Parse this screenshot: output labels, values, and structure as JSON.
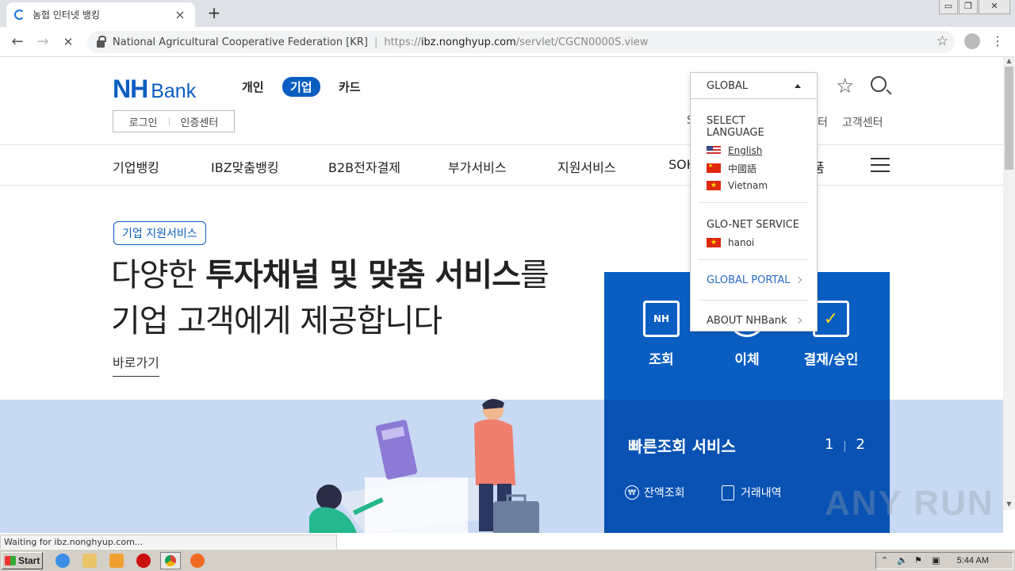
{
  "browser": {
    "tab_title": "농협 인터넷 뱅킹",
    "tab_close": "×",
    "new_tab": "+",
    "win_min": "▭",
    "win_max": "❐",
    "win_close": "✕",
    "back": "←",
    "forward": "→",
    "reload": "✕",
    "site_name": "National Agricultural Cooperative Federation [KR]",
    "url_scheme": "https://",
    "url_host": "ibz.nonghyup.com",
    "url_path": "/servlet/CGCN0000S.view",
    "star": "☆",
    "menu": "⋮",
    "status_text": "Waiting for ibz.nonghyup.com..."
  },
  "header": {
    "logo_nh": "NH",
    "logo_bank": "Bank",
    "segments": [
      "개인",
      "기업",
      "카드"
    ],
    "active_segment": "기업",
    "login": "로그인",
    "cert": "인증센터",
    "util_links": [
      "터",
      "고객센터"
    ],
    "util_partial": "S",
    "global": "GLOBAL"
  },
  "gnb": [
    "기업뱅킹",
    "IBZ맞춤뱅킹",
    "B2B전자결제",
    "부가서비스",
    "지원서비스",
    "SOH",
    "품"
  ],
  "hero": {
    "badge": "기업 지원서비스",
    "line1_pre": "다양한 ",
    "line1_bold": "투자채널 및 맞춤 서비스",
    "line1_post": "를",
    "line2": "기업 고객에게 제공합니다",
    "shortcut": "바로가기"
  },
  "quick_panel": {
    "icons": [
      {
        "label": "조회",
        "glyph": "NH"
      },
      {
        "label": "이체",
        "glyph": ""
      },
      {
        "label": "결재/승인",
        "glyph": "✓"
      }
    ],
    "title": "빠른조회 서비스",
    "page_current": "1",
    "page_sep": "|",
    "page_total": "2",
    "link1": "잔액조회",
    "link1_glyph": "₩",
    "link2": "거래내역"
  },
  "dropdown": {
    "select_language": "SELECT LANGUAGE",
    "languages": [
      {
        "label": "English",
        "flag": "us-flag-icon"
      },
      {
        "label": "中國語",
        "flag": "cn-flag-icon"
      },
      {
        "label": "Vietnam",
        "flag": "vn-flag-icon"
      }
    ],
    "glonet_title": "GLO-NET SERVICE",
    "glonet_item": "hanoi",
    "global_portal": "GLOBAL PORTAL",
    "about": "ABOUT NHBank"
  },
  "watermark": "ANY RUN",
  "taskbar": {
    "start": "Start",
    "clock": "5:44 AM"
  },
  "colors": {
    "brand_blue": "#0a5ec2",
    "panel_dark": "#0952b3",
    "hero_band": "#c7d9f3"
  }
}
